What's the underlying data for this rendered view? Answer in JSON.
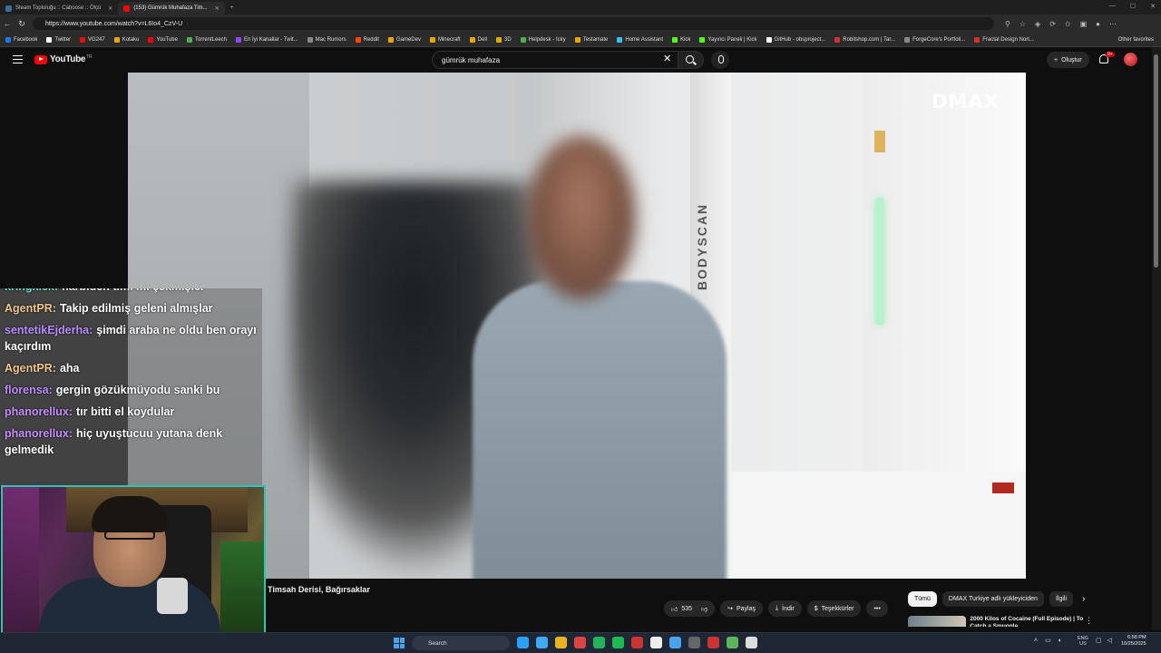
{
  "browser": {
    "tabs": [
      {
        "label": "Steam Topluluğu :: Caboose :: Ölçü",
        "active": false,
        "favicon_color": "#1b2838"
      },
      {
        "label": "(153) Gümrük Muhafaza Tim...",
        "active": true,
        "favicon_color": "#ff0000"
      }
    ],
    "new_tab": "+",
    "url": "https://www.youtube.com/watch?v=L6Io4_CzV-U",
    "bookmarks": [
      {
        "label": "Facebook",
        "color": "#1877f2"
      },
      {
        "label": "Twitter",
        "color": "#ffffff"
      },
      {
        "label": "VG247",
        "color": "#d11"
      },
      {
        "label": "Kotaku",
        "color": "#e6a700"
      },
      {
        "label": "YouTube",
        "color": "#ff0000"
      },
      {
        "label": "TorrentLeech",
        "color": "#5a5"
      },
      {
        "label": "En İyi Kanallar - Twit...",
        "color": "#9146ff"
      },
      {
        "label": "Mac Rumors",
        "color": "#888"
      },
      {
        "label": "Reddit",
        "color": "#ff4500"
      },
      {
        "label": "GameDev",
        "color": "#e6a700"
      },
      {
        "label": "Minecraft",
        "color": "#e6a700"
      },
      {
        "label": "Dell",
        "color": "#e6a700"
      },
      {
        "label": "3D",
        "color": "#e6a700"
      },
      {
        "label": "Helpdesk - Icky",
        "color": "#4caf50"
      },
      {
        "label": "Testamate",
        "color": "#e6a700"
      },
      {
        "label": "Home Assistant",
        "color": "#41bdf5"
      },
      {
        "label": "Kick",
        "color": "#53fc18"
      },
      {
        "label": "Yayıncı Paneli | Kick",
        "color": "#53fc18"
      },
      {
        "label": "GitHub - obsproject...",
        "color": "#ffffff"
      },
      {
        "label": "Robitshop.com | Tar...",
        "color": "#c33"
      },
      {
        "label": "ForgeCore's Portfoli...",
        "color": "#888"
      },
      {
        "label": "Fractal Design Nort...",
        "color": "#c33"
      }
    ],
    "other_favorites": "Other favorites"
  },
  "youtube": {
    "logo": "YouTube",
    "region": "TR",
    "search_query": "gümrük muhafaza",
    "create_label": "Oluştur",
    "notif_count": "9+"
  },
  "video": {
    "channel_watermark": "DMAX",
    "scanner_text": "BODYSCAN",
    "title": "Timsah Derisi, Bağırsaklar",
    "likes": "535",
    "share_label": "Paylaş",
    "download_label": "İndir",
    "thanks_label": "Teşekkürler",
    "more": "•••"
  },
  "chips": {
    "items": [
      "Tümü",
      "DMAX Turkiye adlı yükleyiciden",
      "İlgili"
    ],
    "next": "›"
  },
  "related": {
    "title": "2000 Kilos of Cocaine (Full Episode) | To Catch a Smuggle...",
    "menu": "⋮"
  },
  "chat": {
    "messages": [
      {
        "user": "kringkick:",
        "text": "harbiden timi mi çekmişler",
        "color": "#6fe0d0",
        "cut": true
      },
      {
        "user": "AgentPR:",
        "text": "Takip edilmiş geleni almışlar",
        "color": "#f2c48d"
      },
      {
        "user": "sentetikEjderha:",
        "text": "şimdi araba ne oldu ben orayı kaçırdım",
        "color": "#b98cff"
      },
      {
        "user": "AgentPR:",
        "text": "aha",
        "color": "#f2c48d"
      },
      {
        "user": "florensa:",
        "text": "gergin gözükmüyodu sanki bu",
        "color": "#b98cff"
      },
      {
        "user": "phanorellux:",
        "text": "tır bitti el koydular",
        "color": "#c68cff"
      },
      {
        "user": "phanorellux:",
        "text": "hiç uyuştucuu yutana denk gelmedik",
        "color": "#c68cff"
      }
    ]
  },
  "taskbar": {
    "search_label": "Search",
    "apps": [
      "#2aa1f4",
      "#3fa9f5",
      "#e6b422",
      "#d44",
      "#21b35a",
      "#1db954",
      "#c33",
      "#eee",
      "#4aa3f0",
      "#666",
      "#c33",
      "#5bb55b",
      "#ddd"
    ],
    "lang_top": "ENG",
    "lang_bottom": "US",
    "time": "6:58 PM",
    "date": "10/25/2025"
  }
}
